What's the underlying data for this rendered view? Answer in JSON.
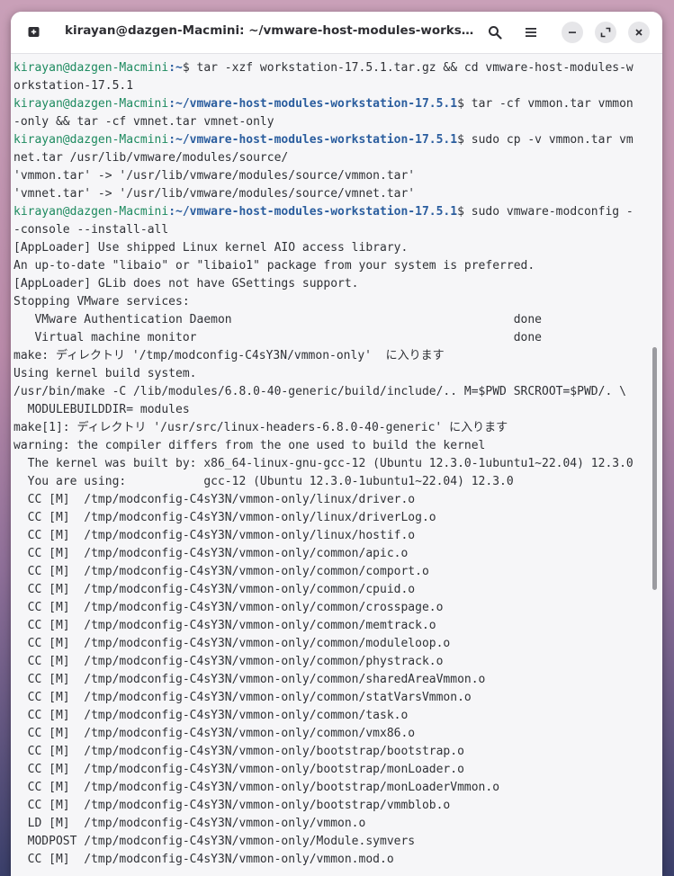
{
  "window": {
    "title": "kirayan@dazgen-Macmini: ~/vmware-host-modules-workstation-..."
  },
  "icons": {
    "new_tab": "new-tab-icon",
    "search": "search-icon",
    "menu": "hamburger-menu-icon",
    "minimize": "minimize-icon",
    "maximize": "maximize-icon",
    "close": "close-icon"
  },
  "colors": {
    "prompt_user": "#1d8a5f",
    "prompt_path": "#2a5d9e",
    "text": "#2f3136"
  },
  "terminal": {
    "lines": [
      {
        "user": "kirayan@dazgen-Macmini",
        "path": ":~",
        "cmd": "$ tar -xzf workstation-17.5.1.tar.gz && cd vmware-host-modules-w"
      },
      {
        "text": "orkstation-17.5.1"
      },
      {
        "user": "kirayan@dazgen-Macmini",
        "path": ":~/vmware-host-modules-workstation-17.5.1",
        "cmd": "$ tar -cf vmmon.tar vmmon"
      },
      {
        "text": "-only && tar -cf vmnet.tar vmnet-only"
      },
      {
        "user": "kirayan@dazgen-Macmini",
        "path": ":~/vmware-host-modules-workstation-17.5.1",
        "cmd": "$ sudo cp -v vmmon.tar vm"
      },
      {
        "text": "net.tar /usr/lib/vmware/modules/source/"
      },
      {
        "text": "'vmmon.tar' -> '/usr/lib/vmware/modules/source/vmmon.tar'"
      },
      {
        "text": "'vmnet.tar' -> '/usr/lib/vmware/modules/source/vmnet.tar'"
      },
      {
        "user": "kirayan@dazgen-Macmini",
        "path": ":~/vmware-host-modules-workstation-17.5.1",
        "cmd": "$ sudo vmware-modconfig -"
      },
      {
        "text": "-console --install-all"
      },
      {
        "text": "[AppLoader] Use shipped Linux kernel AIO access library."
      },
      {
        "text": "An up-to-date \"libaio\" or \"libaio1\" package from your system is preferred."
      },
      {
        "text": "[AppLoader] GLib does not have GSettings support."
      },
      {
        "text": "Stopping VMware services:"
      },
      {
        "text": "   VMware Authentication Daemon                                        done"
      },
      {
        "text": "   Virtual machine monitor                                             done"
      },
      {
        "text": "make: ディレクトリ '/tmp/modconfig-C4sY3N/vmmon-only'  に入ります"
      },
      {
        "text": "Using kernel build system."
      },
      {
        "text": "/usr/bin/make -C /lib/modules/6.8.0-40-generic/build/include/.. M=$PWD SRCROOT=$PWD/. \\"
      },
      {
        "text": "  MODULEBUILDDIR= modules"
      },
      {
        "text": "make[1]: ディレクトリ '/usr/src/linux-headers-6.8.0-40-generic' に入ります"
      },
      {
        "text": "warning: the compiler differs from the one used to build the kernel"
      },
      {
        "text": "  The kernel was built by: x86_64-linux-gnu-gcc-12 (Ubuntu 12.3.0-1ubuntu1~22.04) 12.3.0"
      },
      {
        "text": "  You are using:           gcc-12 (Ubuntu 12.3.0-1ubuntu1~22.04) 12.3.0"
      },
      {
        "text": "  CC [M]  /tmp/modconfig-C4sY3N/vmmon-only/linux/driver.o"
      },
      {
        "text": "  CC [M]  /tmp/modconfig-C4sY3N/vmmon-only/linux/driverLog.o"
      },
      {
        "text": "  CC [M]  /tmp/modconfig-C4sY3N/vmmon-only/linux/hostif.o"
      },
      {
        "text": "  CC [M]  /tmp/modconfig-C4sY3N/vmmon-only/common/apic.o"
      },
      {
        "text": "  CC [M]  /tmp/modconfig-C4sY3N/vmmon-only/common/comport.o"
      },
      {
        "text": "  CC [M]  /tmp/modconfig-C4sY3N/vmmon-only/common/cpuid.o"
      },
      {
        "text": "  CC [M]  /tmp/modconfig-C4sY3N/vmmon-only/common/crosspage.o"
      },
      {
        "text": "  CC [M]  /tmp/modconfig-C4sY3N/vmmon-only/common/memtrack.o"
      },
      {
        "text": "  CC [M]  /tmp/modconfig-C4sY3N/vmmon-only/common/moduleloop.o"
      },
      {
        "text": "  CC [M]  /tmp/modconfig-C4sY3N/vmmon-only/common/phystrack.o"
      },
      {
        "text": "  CC [M]  /tmp/modconfig-C4sY3N/vmmon-only/common/sharedAreaVmmon.o"
      },
      {
        "text": "  CC [M]  /tmp/modconfig-C4sY3N/vmmon-only/common/statVarsVmmon.o"
      },
      {
        "text": "  CC [M]  /tmp/modconfig-C4sY3N/vmmon-only/common/task.o"
      },
      {
        "text": "  CC [M]  /tmp/modconfig-C4sY3N/vmmon-only/common/vmx86.o"
      },
      {
        "text": "  CC [M]  /tmp/modconfig-C4sY3N/vmmon-only/bootstrap/bootstrap.o"
      },
      {
        "text": "  CC [M]  /tmp/modconfig-C4sY3N/vmmon-only/bootstrap/monLoader.o"
      },
      {
        "text": "  CC [M]  /tmp/modconfig-C4sY3N/vmmon-only/bootstrap/monLoaderVmmon.o"
      },
      {
        "text": "  CC [M]  /tmp/modconfig-C4sY3N/vmmon-only/bootstrap/vmmblob.o"
      },
      {
        "text": "  LD [M]  /tmp/modconfig-C4sY3N/vmmon-only/vmmon.o"
      },
      {
        "text": "  MODPOST /tmp/modconfig-C4sY3N/vmmon-only/Module.symvers"
      },
      {
        "text": "  CC [M]  /tmp/modconfig-C4sY3N/vmmon-only/vmmon.mod.o"
      }
    ]
  }
}
